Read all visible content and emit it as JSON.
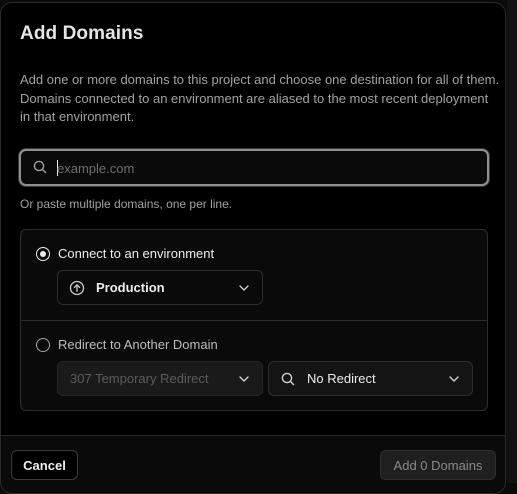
{
  "dialog": {
    "title": "Add Domains",
    "description": "Add one or more domains to this project and choose one destination for all of them. Domains connected to an environment are aliased to the most recent deployment in that environment."
  },
  "search": {
    "placeholder": "example.com",
    "value": "",
    "icon": "search-icon"
  },
  "paste_hint": "Or paste multiple domains, one per line.",
  "options": {
    "connect": {
      "label": "Connect to an environment",
      "selected": true,
      "environment": {
        "value": "Production",
        "icon": "arrow-up-circle-icon"
      }
    },
    "redirect": {
      "label": "Redirect to Another Domain",
      "selected": false,
      "status_select": "307 Temporary Redirect",
      "target_select": "No Redirect"
    }
  },
  "footer": {
    "cancel_label": "Cancel",
    "add_label": "Add 0 Domains"
  },
  "colors": {
    "background": "#000000",
    "border": "#2e2e2e",
    "text": "#ededed",
    "muted": "#a1a1a1"
  }
}
